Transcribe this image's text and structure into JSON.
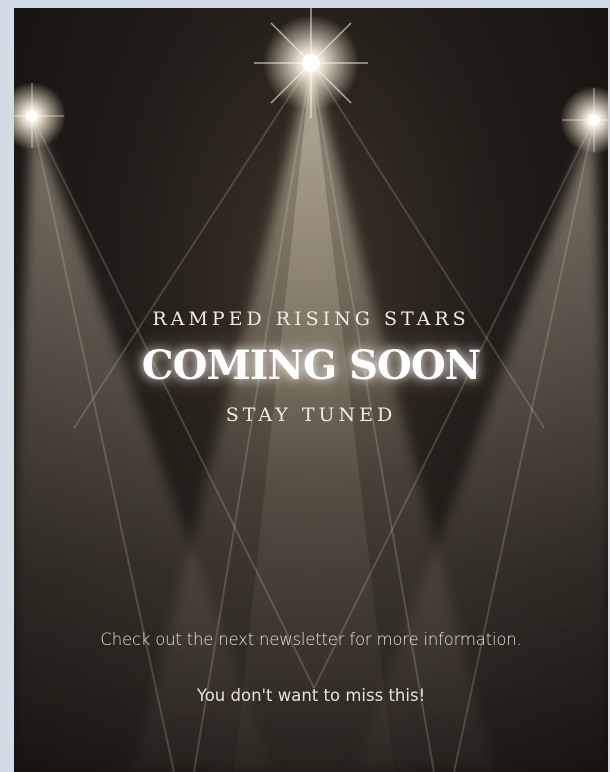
{
  "poster": {
    "subtitle": "RAMPED RISING STARS",
    "headline": "COMING SOON",
    "tagline": "STAY TUNED",
    "info": "Check out the next newsletter for more information.",
    "note": "You don't want to miss this!"
  },
  "colors": {
    "page_background": "#d4dce8",
    "poster_background": "#221d18",
    "light_beam": "#f5e9d2"
  },
  "icons": [
    "spotlight-left-icon",
    "spotlight-center-icon",
    "spotlight-right-icon"
  ]
}
